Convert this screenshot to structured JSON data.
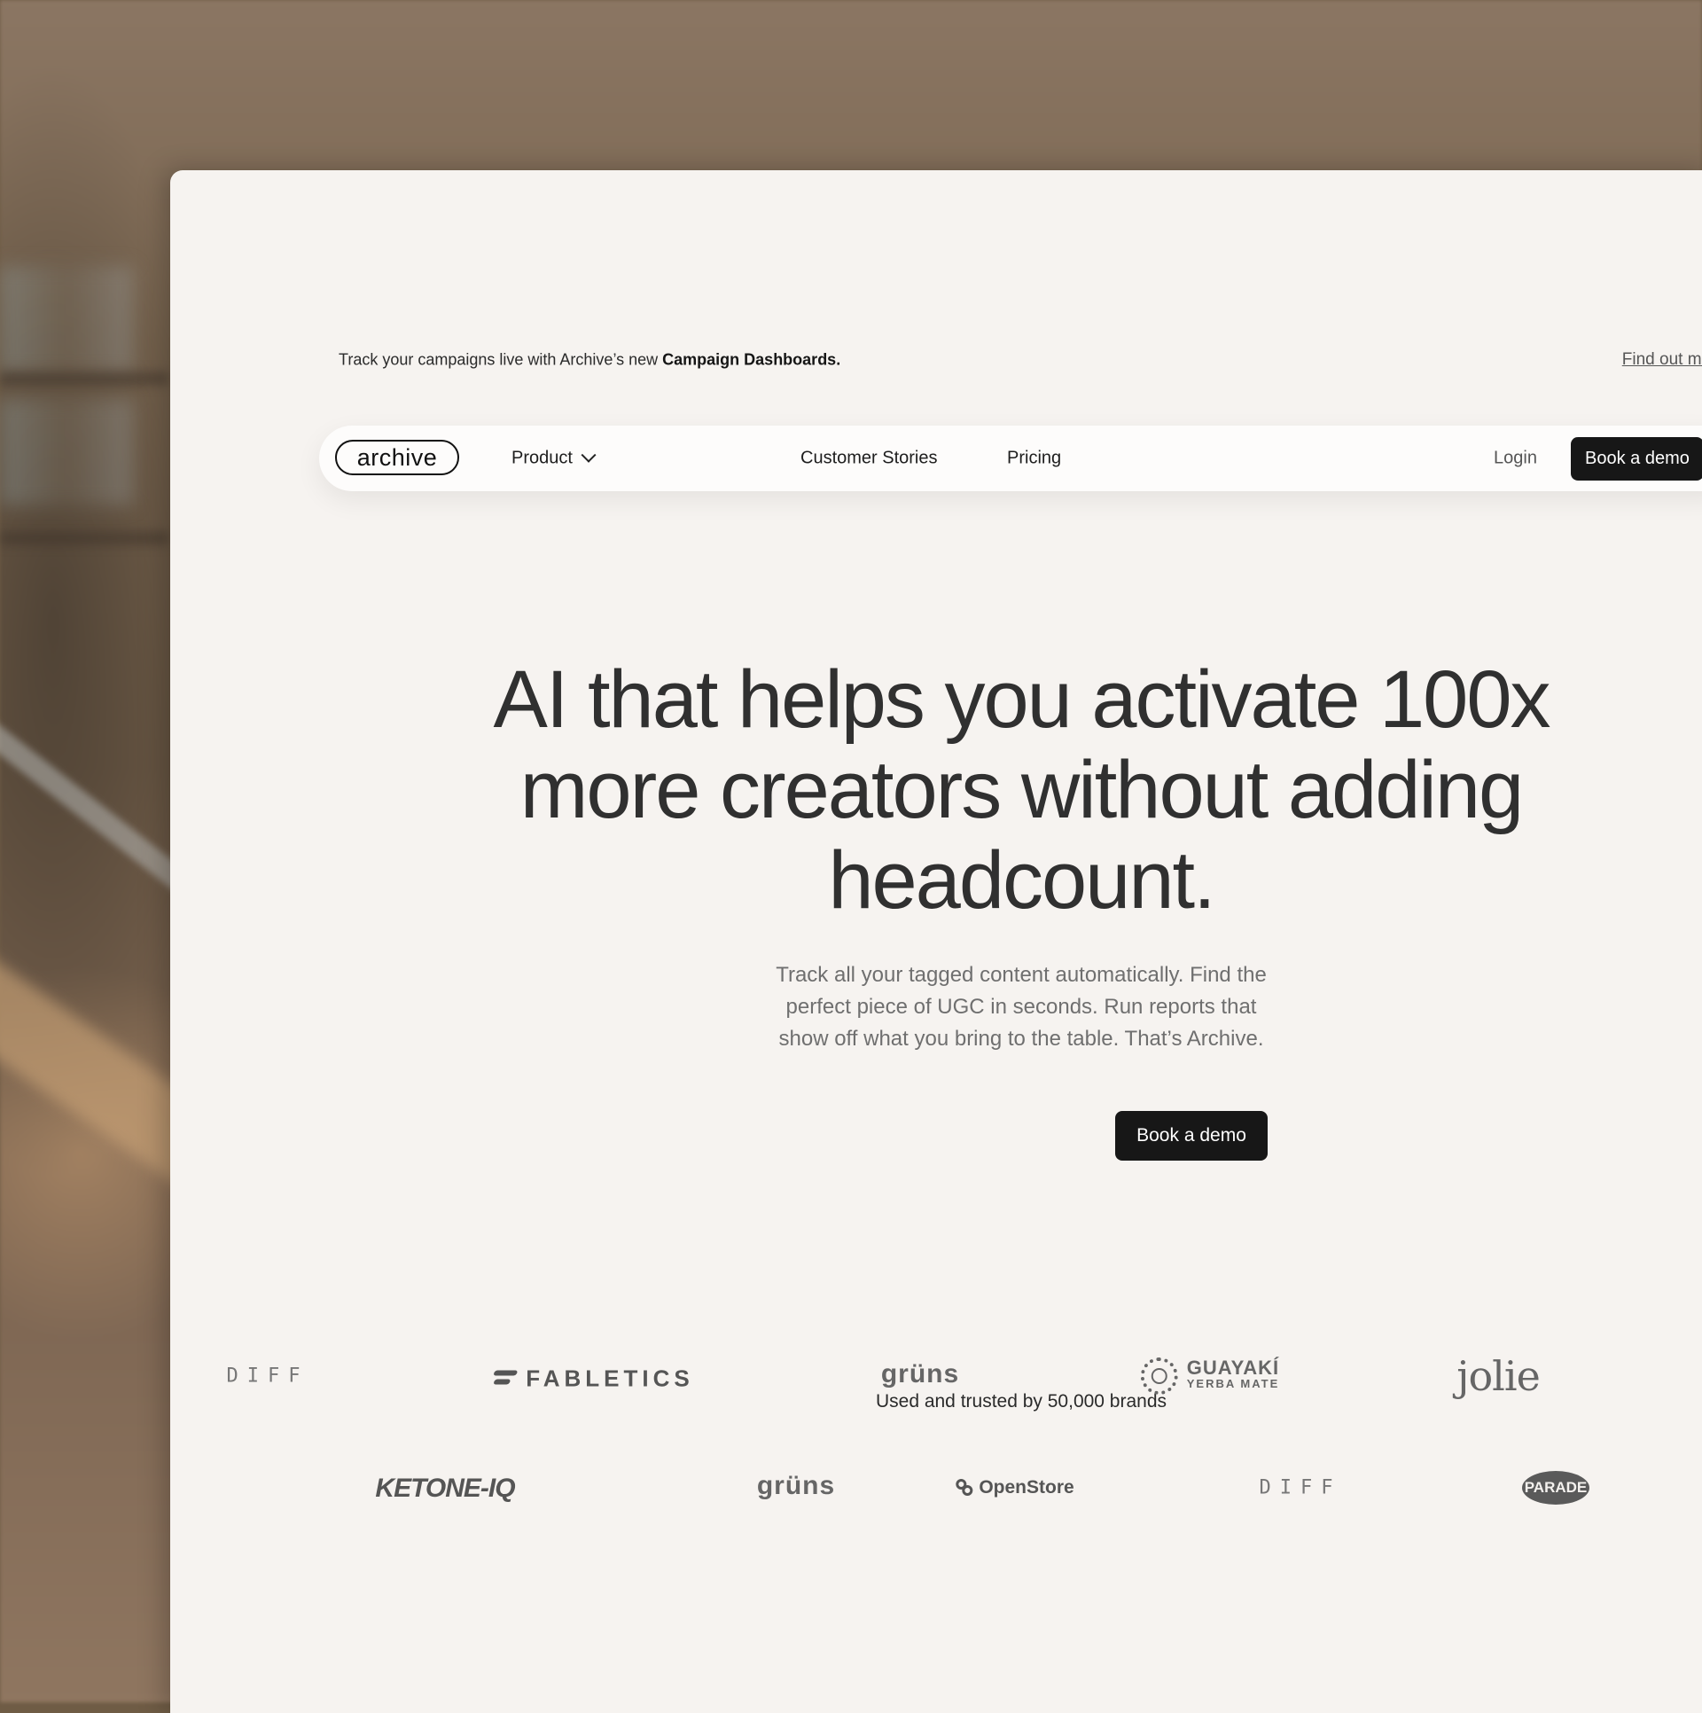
{
  "announcement": {
    "text": "Track your campaigns live with Archive’s new ",
    "bold": "Campaign  Dashboards.",
    "link": "Find out more"
  },
  "nav": {
    "logo": "archive",
    "items": [
      "Product",
      "Customer Stories",
      "Pricing"
    ],
    "login": "Login",
    "demo": "Book a demo"
  },
  "hero": {
    "line1": "AI that helps you activate 100x",
    "line2": "more creators without adding",
    "line3": "headcount.",
    "sub1": "Track all your tagged content automatically. Find the",
    "sub2": "perfect piece of UGC in seconds. Run reports that",
    "sub3": "show off what you bring to the table. That’s Archive.",
    "cta": "Book a demo"
  },
  "trusted": {
    "label": "Used and trusted by 50,000 brands",
    "row1": [
      "DIFF",
      "FABLETICS",
      "grüns",
      "GUAYAKÍ",
      "YERBA MATE",
      "jolie"
    ],
    "row2": [
      "KETONE-IQ",
      "grüns",
      "OpenStore",
      "DIFF",
      "PARADE"
    ]
  }
}
